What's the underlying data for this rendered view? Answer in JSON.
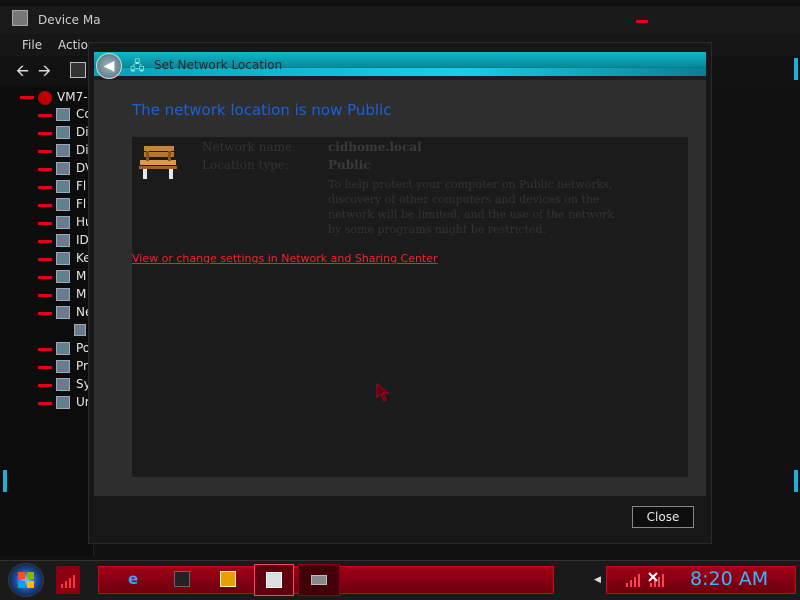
{
  "background_window": {
    "title": "Device Ma",
    "menu": [
      "File",
      "Action"
    ],
    "tree_root": "VM7-",
    "tree_items": [
      "Co",
      "Di",
      "Di",
      "DV",
      "Fl",
      "Fl",
      "Hu",
      "ID",
      "Ke",
      "M",
      "M",
      "Ne",
      "",
      "Po",
      "Pr",
      "Sy",
      "Ur"
    ]
  },
  "dialog": {
    "title": "Set Network Location",
    "headline": "The network location is now Public",
    "network_name_label": "Network name:",
    "network_name_value": "cidhome.local",
    "location_type_label": "Location type:",
    "location_type_value": "Public",
    "description": "To help protect your computer on Public networks, discovery of other computers and devices on the network will be limited, and the use of the network by some programs might be restricted.",
    "link": "View or change settings in Network and Sharing Center",
    "close_button": "Close"
  },
  "taskbar": {
    "clock": "8:20 AM",
    "quick_launch_icons": [
      "ie-icon",
      "sidebar-icon",
      "media-player-icon"
    ],
    "task_buttons": [
      "device-manager-task",
      "network-task"
    ]
  },
  "colors": {
    "accent_cyan": "#16d0e8",
    "accent_red": "#e0001a",
    "headline_blue": "#1e5fd8",
    "clock_blue": "#39b6ff"
  }
}
